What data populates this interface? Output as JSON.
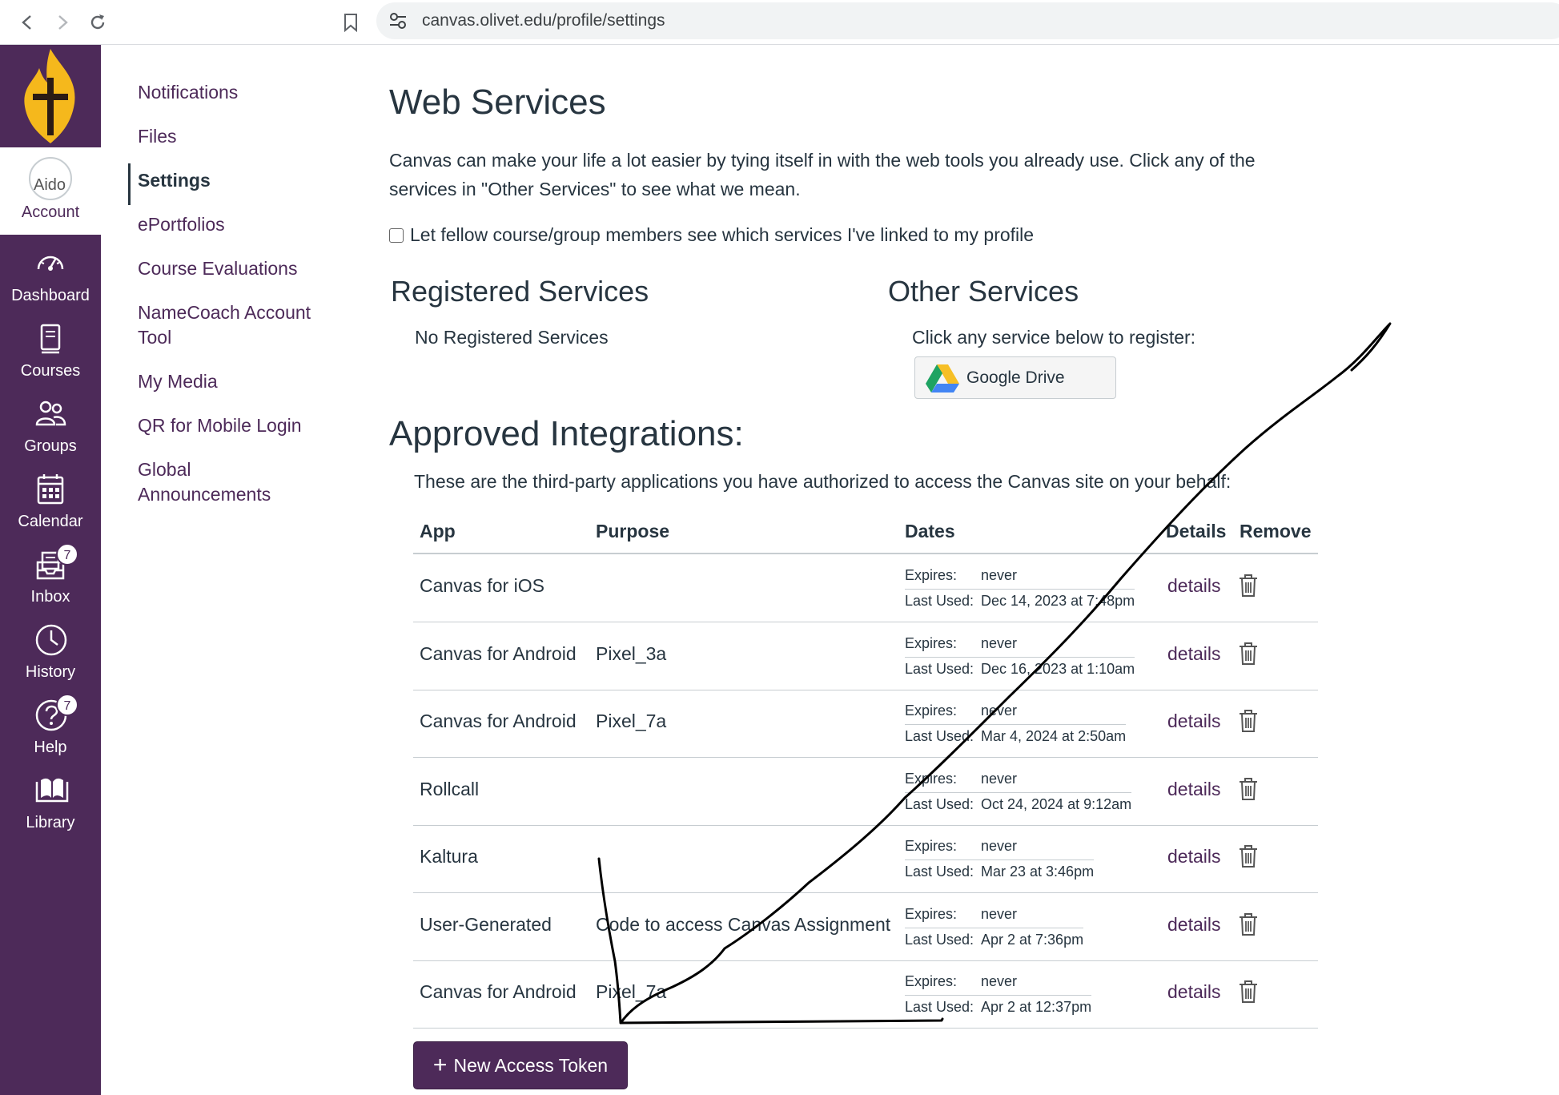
{
  "browser": {
    "url": "canvas.olivet.edu/profile/settings"
  },
  "global_nav": {
    "account": {
      "avatar_alt": "Aido",
      "label": "Account"
    },
    "items": [
      {
        "label": "Dashboard",
        "icon": "dashboard-icon"
      },
      {
        "label": "Courses",
        "icon": "courses-icon"
      },
      {
        "label": "Groups",
        "icon": "groups-icon"
      },
      {
        "label": "Calendar",
        "icon": "calendar-icon"
      },
      {
        "label": "Inbox",
        "icon": "inbox-icon",
        "badge": "7"
      },
      {
        "label": "History",
        "icon": "history-icon"
      },
      {
        "label": "Help",
        "icon": "help-icon",
        "badge": "7"
      },
      {
        "label": "Library",
        "icon": "library-icon"
      }
    ]
  },
  "sub_nav": {
    "items": [
      {
        "label": "Notifications"
      },
      {
        "label": "Files"
      },
      {
        "label": "Settings",
        "active": true
      },
      {
        "label": "ePortfolios"
      },
      {
        "label": "Course Evaluations"
      },
      {
        "label": "NameCoach Account Tool"
      },
      {
        "label": "My Media"
      },
      {
        "label": "QR for Mobile Login"
      },
      {
        "label": "Global Announcements"
      }
    ]
  },
  "main": {
    "title": "Web Services",
    "intro": "Canvas can make your life a lot easier by tying itself in with the web tools you already use. Click any of the services in \"Other Services\" to see what we mean.",
    "share_checkbox_label": "Let fellow course/group members see which services I've linked to my profile",
    "registered": {
      "heading": "Registered Services",
      "empty": "No Registered Services"
    },
    "other": {
      "heading": "Other Services",
      "prompt": "Click any service below to register:",
      "google_drive": "Google Drive"
    },
    "integrations": {
      "heading": "Approved Integrations:",
      "description": "These are the third-party applications you have authorized to access the Canvas site on your behalf:",
      "columns": {
        "app": "App",
        "purpose": "Purpose",
        "dates": "Dates",
        "details": "Details",
        "remove": "Remove"
      },
      "expires_label": "Expires:",
      "last_used_label": "Last Used:",
      "details_link": "details",
      "rows": [
        {
          "app": "Canvas for iOS",
          "purpose": "",
          "expires": "never",
          "last_used": "Dec 14, 2023 at 7:48pm"
        },
        {
          "app": "Canvas for Android",
          "purpose": "Pixel_3a",
          "expires": "never",
          "last_used": "Dec 16, 2023 at 1:10am"
        },
        {
          "app": "Canvas for Android",
          "purpose": "Pixel_7a",
          "expires": "never",
          "last_used": "Mar 4, 2024 at 2:50am"
        },
        {
          "app": "Rollcall",
          "purpose": "",
          "expires": "never",
          "last_used": "Oct 24, 2024 at 9:12am"
        },
        {
          "app": "Kaltura",
          "purpose": "",
          "expires": "never",
          "last_used": "Mar 23 at 3:46pm"
        },
        {
          "app": "User-Generated",
          "purpose": "Code to access Canvas Assignment",
          "expires": "never",
          "last_used": "Apr 2 at 7:36pm"
        },
        {
          "app": "Canvas for Android",
          "purpose": "Pixel_7a",
          "expires": "never",
          "last_used": "Apr 2 at 12:37pm"
        }
      ]
    },
    "new_token_button": "New Access Token"
  }
}
